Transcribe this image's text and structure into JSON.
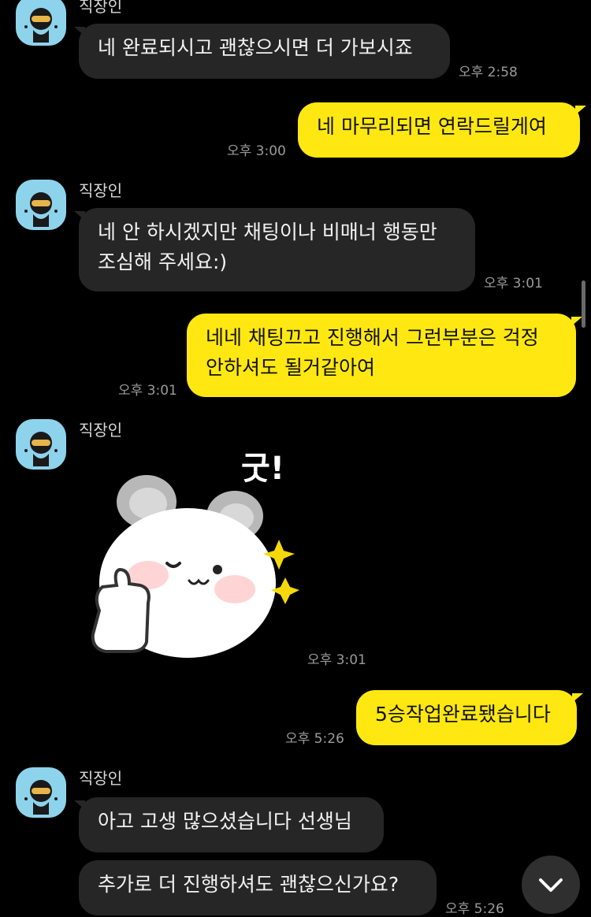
{
  "chat": {
    "sender_name": "직장인",
    "messages": [
      {
        "from": "them",
        "text": "네 완료되시고 괜찮으시면 더 가보시죠",
        "time": "오후 2:58"
      },
      {
        "from": "me",
        "text": "네 마무리되면 연락드릴게여",
        "time": "오후 3:00"
      },
      {
        "from": "them",
        "lines": [
          "네 안 하시겠지만 채팅이나 비매너 행동만",
          "조심해 주세요:)"
        ],
        "time": "오후 3:01"
      },
      {
        "from": "me",
        "lines": [
          "네네 채팅끄고 진행해서 그런부분은 걱정",
          "안하셔도 될거같아여"
        ],
        "time": "오후 3:01"
      },
      {
        "from": "them",
        "sticker": "thumbs-up-bear-sticker",
        "sticker_text": "굿!",
        "time": "오후 3:01"
      },
      {
        "from": "me",
        "text": "5승작업완료됐습니다",
        "time": "오후 5:26"
      },
      {
        "from": "them",
        "text": "아고 고생 많으셨습니다 선생님"
      },
      {
        "from": "them",
        "text": "추가로 더 진행하셔도 괜찮으신가요?",
        "time": "오후 5:26"
      }
    ]
  },
  "colors": {
    "background": "#000000",
    "incoming_bubble": "#262626",
    "outgoing_bubble": "#ffe812",
    "time_text": "#9a9a9a",
    "avatar_bg": "#8ed3ec"
  },
  "icons": {
    "avatar": "profile-avatar-icon",
    "scroll_down": "chevron-down-icon"
  }
}
